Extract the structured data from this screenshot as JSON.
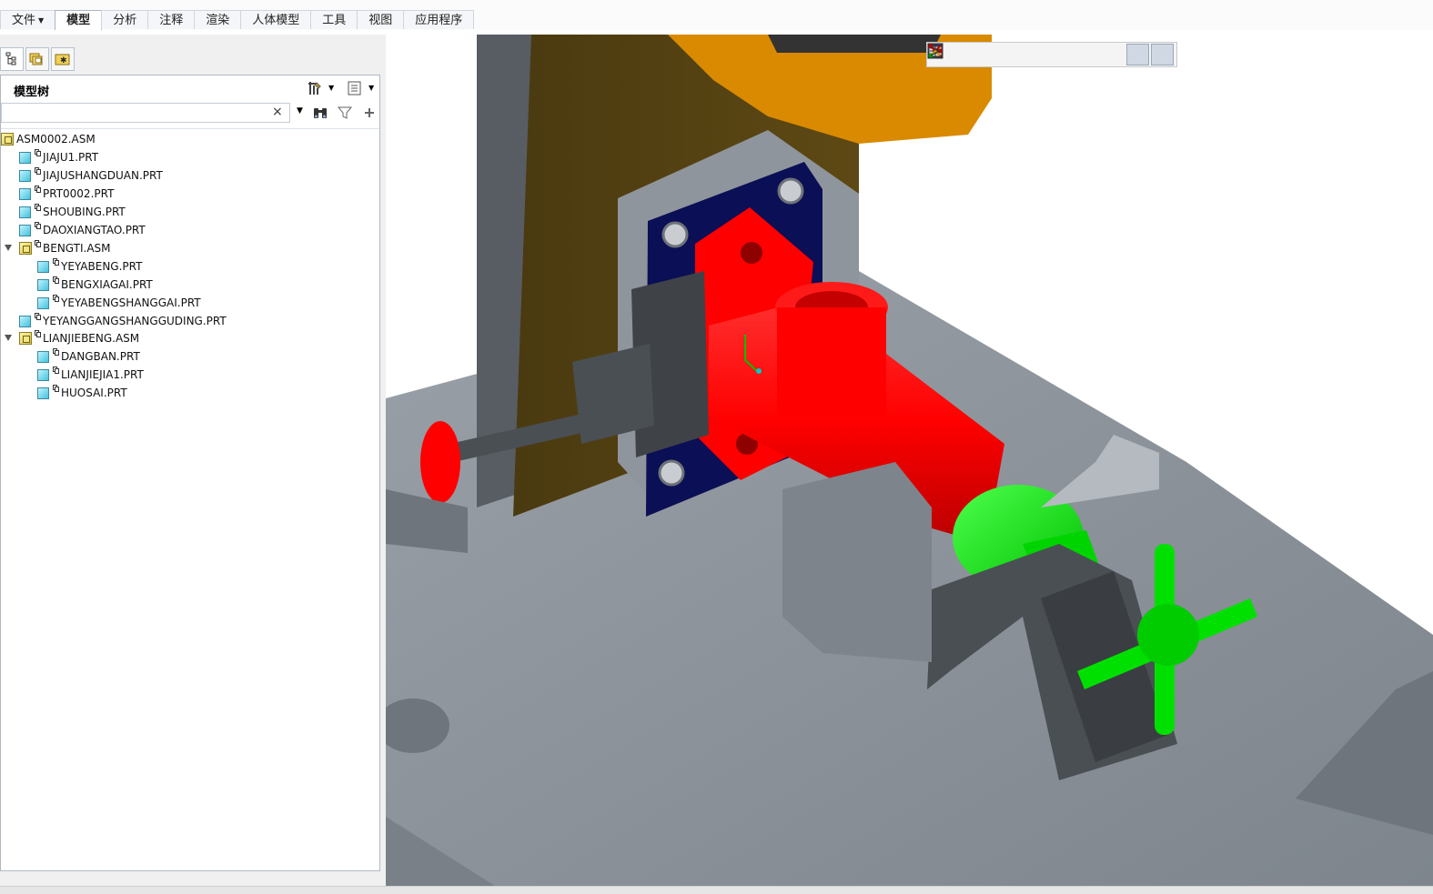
{
  "ribbon": {
    "file_label": "文件",
    "tabs": [
      {
        "label": "模型",
        "active": true
      },
      {
        "label": "分析"
      },
      {
        "label": "注释"
      },
      {
        "label": "渲染"
      },
      {
        "label": "人体模型"
      },
      {
        "label": "工具"
      },
      {
        "label": "视图"
      },
      {
        "label": "应用程序"
      }
    ]
  },
  "navigator": {
    "tabs": [
      "model-tree-tab-icon",
      "folder-browser-tab-icon",
      "favorites-tab-icon"
    ]
  },
  "model_tree": {
    "title": "模型树",
    "search_value": "",
    "clear_symbol": "×",
    "items": [
      {
        "label": "ASM0002.ASM",
        "type": "asm",
        "level": 0,
        "expanded": null
      },
      {
        "label": "JIAJU1.PRT",
        "type": "part",
        "level": 1
      },
      {
        "label": "JIAJUSHANGDUAN.PRT",
        "type": "part",
        "level": 1
      },
      {
        "label": "PRT0002.PRT",
        "type": "part",
        "level": 1
      },
      {
        "label": "SHOUBING.PRT",
        "type": "part",
        "level": 1
      },
      {
        "label": "DAOXIANGTAO.PRT",
        "type": "part",
        "level": 1
      },
      {
        "label": "BENGTI.ASM",
        "type": "asm",
        "level": 1,
        "expanded": true
      },
      {
        "label": "YEYABENG.PRT",
        "type": "part",
        "level": 2
      },
      {
        "label": "BENGXIAGAI.PRT",
        "type": "part",
        "level": 2
      },
      {
        "label": "YEYABENGSHANGGAI.PRT",
        "type": "part",
        "level": 2
      },
      {
        "label": "YEYANGGANGSHANGGUDING.PRT",
        "type": "part",
        "level": 1
      },
      {
        "label": "LIANJIEBENG.ASM",
        "type": "asm",
        "level": 1,
        "expanded": true
      },
      {
        "label": "DANGBAN.PRT",
        "type": "part",
        "level": 2
      },
      {
        "label": "LIANJIEJIA1.PRT",
        "type": "part",
        "level": 2
      },
      {
        "label": "HUOSAI.PRT",
        "type": "part",
        "level": 2
      }
    ]
  },
  "view_toolbar": {
    "tools": [
      "refit-icon",
      "zoom-in-icon",
      "zoom-out-icon",
      "repaint-icon",
      "display-style-icon",
      "saved-views-icon",
      "view-manager-icon",
      "datum-display-icon",
      "spin-center-icon",
      "annotation-display-icon"
    ]
  },
  "colors": {
    "accent_red": "#ff0000",
    "accent_green": "#00ee00",
    "plate_gray": "#8c939b",
    "wood": "#5b4512",
    "orange": "#d98a00",
    "navy": "#0b0f55"
  }
}
